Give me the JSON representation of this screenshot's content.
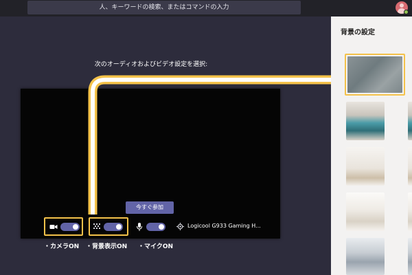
{
  "search": {
    "placeholder": "人、キーワードの検索、またはコマンドの入力"
  },
  "prompt_text": "次のオーディオおよびビデオ設定を選択:",
  "join_button": "今すぐ参加",
  "device_name": "Logicool G933 Gaming H...",
  "controls": {
    "camera_toggle_on": true,
    "background_toggle_on": true,
    "mic_toggle_on": true
  },
  "callouts": {
    "camera": "・カメラON",
    "background": "・背景表示ON",
    "mic": "・マイクON"
  },
  "background_panel": {
    "title": "背景の設定",
    "options": [
      "blur",
      "office-1",
      "room-2",
      "room-3",
      "room-4"
    ],
    "selected": "blur"
  },
  "colors": {
    "accent": "#6264a7",
    "highlight": "#f4c24a",
    "background": "#2d2c3c"
  }
}
